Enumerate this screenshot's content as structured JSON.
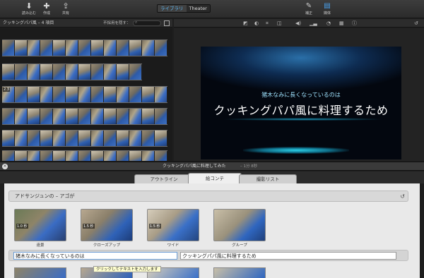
{
  "toolbar": {
    "import_label": "読み込む",
    "create_label": "作成",
    "share_label": "共有",
    "view_tabs": [
      "ライブラリ",
      "Theater"
    ],
    "adjust_label": "補正",
    "media_label": "媒体"
  },
  "library": {
    "title": "クッキングパパ風 – 4 項目",
    "hide_rejected": "不採用を隠す：",
    "search_glyph": "⌕",
    "timecode": "2.3"
  },
  "viewer": {
    "subtitle_small": "猪木なみに長くなっているのは",
    "subtitle_large": "クッキングパパ風に料理するため"
  },
  "project": {
    "title": "クッキングパパ風に料理してみた",
    "duration": "– 1分 8秒"
  },
  "tabs": [
    "アウトライン",
    "絵コンテ",
    "撮影リスト"
  ],
  "storyboard": {
    "act_title": "アドサンジュンの – アゴが",
    "reset_glyph": "↺",
    "shots": [
      {
        "timecode": "1.0 秒",
        "label": "遠景"
      },
      {
        "timecode": "1.5 秒",
        "label": "クローズアップ"
      },
      {
        "timecode": "1.5 秒",
        "label": "ワイド"
      },
      {
        "timecode": "",
        "label": "グループ"
      }
    ],
    "text_field_1": "猪木なみに長くなっているのは",
    "text_field_2": "クッキングパパ風に料理するため",
    "tooltip": "クリックしてテキストを入力します"
  },
  "colors": {
    "accent": "#5db8f5",
    "subtitle": "#9fe3ff"
  }
}
